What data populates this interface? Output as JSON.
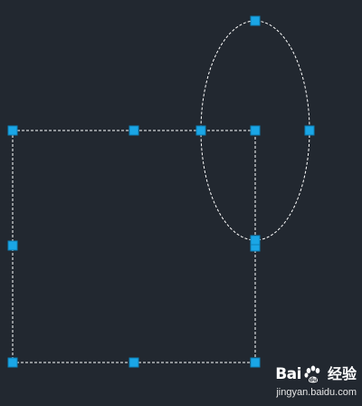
{
  "colors": {
    "background": "#222830",
    "outline": "#ffffff",
    "grip": "#1aa6e6",
    "grip_border": "#0e7fb5"
  },
  "selection": {
    "rectangle": {
      "grips": [
        "corner-tl",
        "mid-top",
        "corner-tr",
        "mid-right",
        "corner-br",
        "mid-bottom",
        "corner-bl",
        "mid-left"
      ]
    },
    "ellipse": {
      "grips": [
        "quadrant-top",
        "quadrant-right",
        "quadrant-bottom",
        "quadrant-left",
        "center"
      ]
    }
  },
  "watermark": {
    "brand_left": "Bai",
    "brand_right": "百",
    "product": "经验",
    "url": "jingyan.baidu.com"
  }
}
